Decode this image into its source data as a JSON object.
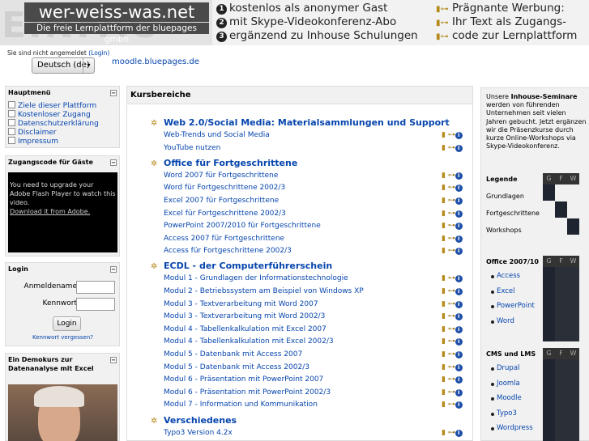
{
  "header": {
    "logo_bg": "EINFAC",
    "logo_title": "wer-weiss-was.net",
    "logo_subtitle": "Die freie Lernplattform der bluepages gmbh",
    "ad1_lines": [
      {
        "num": "1",
        "text": "kostenlos als anonymer Gast"
      },
      {
        "num": "2",
        "text": "mit Skype-Videokonferenz-Abo"
      },
      {
        "num": "3",
        "text": "ergänzend zu Inhouse Schulungen"
      }
    ],
    "ad2_lines": [
      "Prägnante Werbung:",
      "Ihr Text als Zugangs-",
      "code zur Lernplattform"
    ]
  },
  "login_status": {
    "text": "Sie sind nicht angemeldet",
    "link": "(Login)"
  },
  "language": {
    "selected": "Deutsch (de)",
    "arrow": "▾"
  },
  "site_url": "moodle.bluepages.de",
  "main_menu": {
    "title": "Hauptmenü",
    "items": [
      "Ziele dieser Plattform",
      "Kostenloser Zugang",
      "Datenschutzerklärung",
      "Disclaimer",
      "Impressum"
    ]
  },
  "guest_code": {
    "title": "Zugangscode für Gäste",
    "flash_msg": "You need to upgrade your Adobe Flash Player to watch this video.",
    "flash_link": "Download it from Adobe."
  },
  "login": {
    "title": "Login",
    "user_label": "Anmeldename",
    "pass_label": "Kennwort",
    "button": "Login",
    "forgot": "Kennwort vergessen?"
  },
  "demo": {
    "title": "Ein Demokurs zur Datenanalyse mit Excel"
  },
  "toggle_symbol": "−",
  "course_area": {
    "title": "Kursbereiche",
    "info_icons": {
      "i1": "▮",
      "i2": "⊶",
      "i3": "i"
    },
    "categories": [
      {
        "name": "Web 2.0/Social Media: Materialsammlungen und Support",
        "courses": [
          "Web-Trends und Social Media",
          "YouTube nutzen"
        ]
      },
      {
        "name": "Office für Fortgeschrittene",
        "courses": [
          "Word 2007 für Fortgeschrittene",
          "Word für Fortgeschrittene 2002/3",
          "Excel 2007 für Fortgeschrittene",
          "Excel für Fortgeschrittene 2002/3",
          "PowerPoint 2007/2010 für Fortgeschrittene",
          "Access 2007 für Fortgeschrittene",
          "Access für Fortgeschrittene 2002/3"
        ]
      },
      {
        "name": "ECDL - der Computerführerschein",
        "courses": [
          "Modul 1 - Grundlagen der Informationstechnologie",
          "Modul 2 - Betriebssystem am Beispiel von Windows XP",
          "Modul 3 - Textverarbeitung mit Word 2007",
          "Modul 3 - Textverarbeitung mit Word 2002/3",
          "Modul 4 - Tabellenkalkulation mit Excel 2007",
          "Modul 4 - Tabellenkalkulation mit Excel 2002/3",
          "Modul 5 - Datenbank mit Access 2007",
          "Modul 5 - Datenbank mit Access 2002/3",
          "Modul 6 - Präsentation mit PowerPoint 2007",
          "Modul 6 - Präsentation mit PowerPoint 2002/3",
          "Modul 7 - Information und Kommunikation"
        ]
      },
      {
        "name": "Verschiedenes",
        "courses": [
          "Typo3 Version 4.2x"
        ]
      }
    ]
  },
  "seminars": {
    "intro_pre": "Unsere ",
    "intro_bold": "Inhouse-Seminare",
    "intro_post": " werden von führenden Unternehmen seit vielen Jahren gebucht. Jetzt ergänzen wir die Präsenzkurse durch kurze Online-Workshops via Skype-Videokonferenz.",
    "col_heads": [
      "G",
      "F",
      "W"
    ],
    "legend_title": "Legende",
    "legend_rows": [
      "Grundlagen",
      "Fortgeschrittene",
      "Workshops"
    ],
    "office_title": "Office 2007/10",
    "office_items": [
      "Access",
      "Excel",
      "PowerPoint",
      "Word"
    ],
    "cms_title": "CMS und LMS",
    "cms_items": [
      "Drupal",
      "Joomla",
      "Moodle",
      "Typo3",
      "Wordpress"
    ]
  },
  "colors": {
    "link": "#0645ad",
    "accent_gold": "#b58a1b",
    "grid_dark": "#2a2f38",
    "grid_fill": "#1e2430"
  }
}
